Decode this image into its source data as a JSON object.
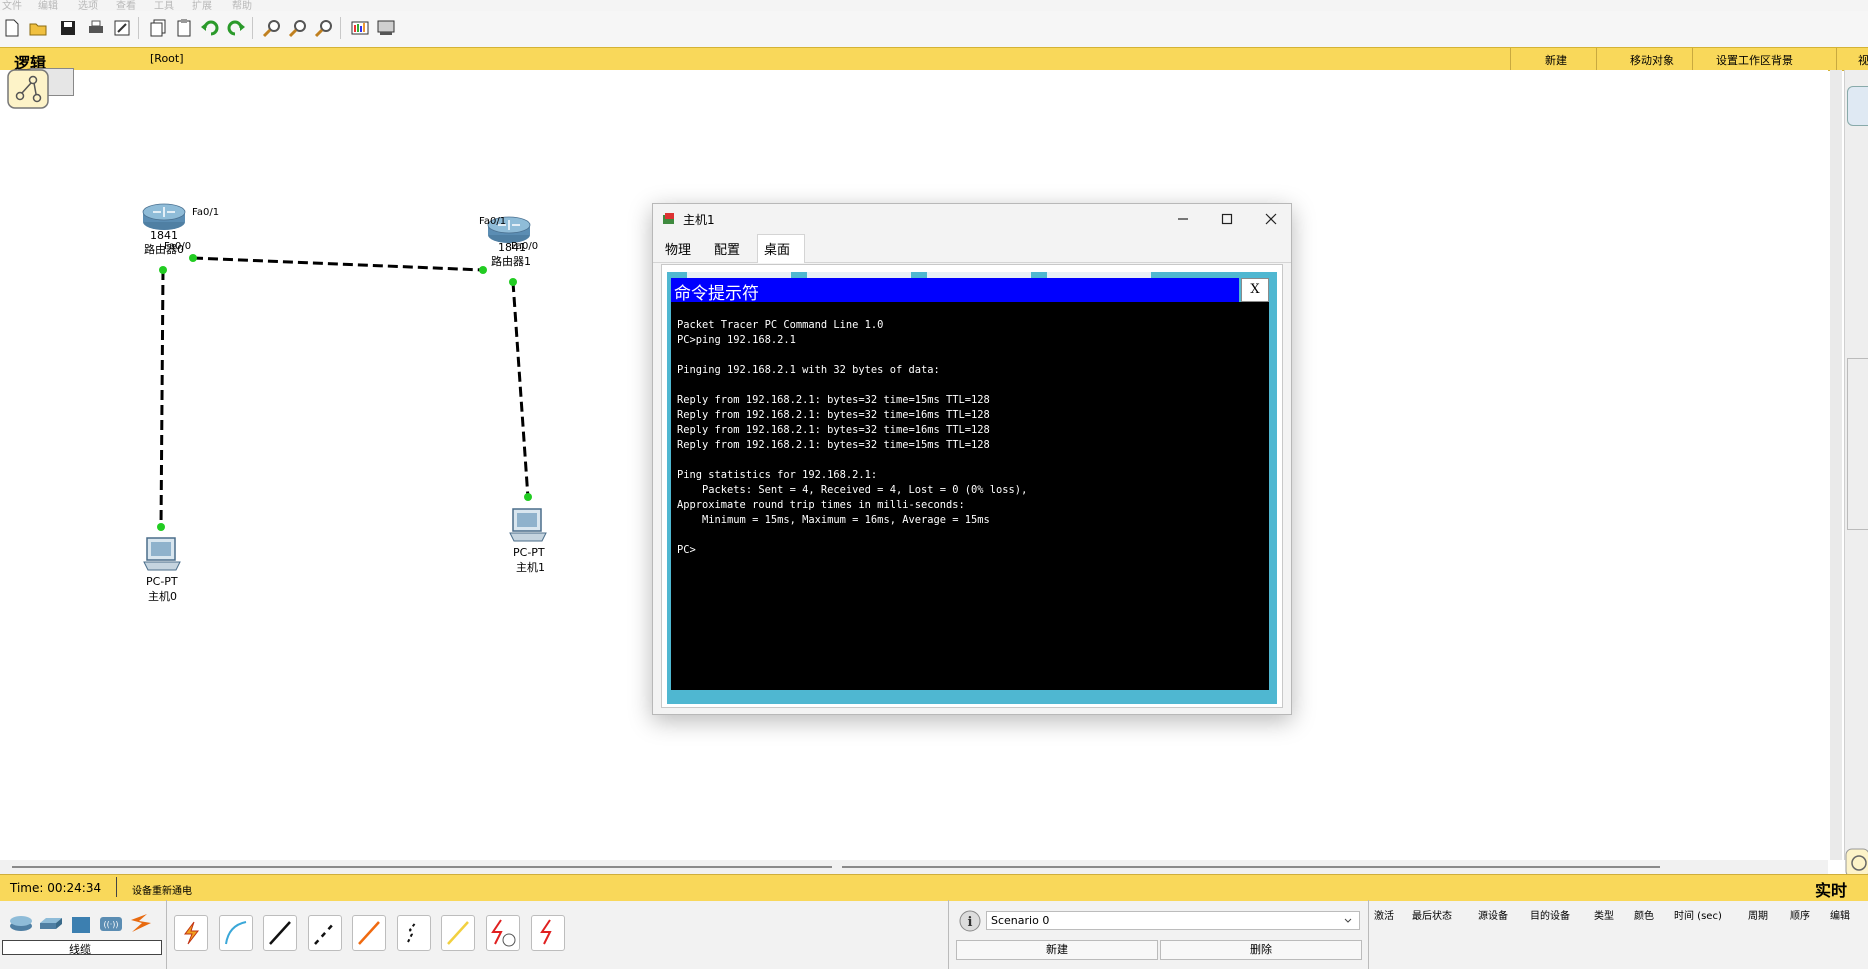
{
  "menu": [
    "文件",
    "编辑",
    "选项",
    "查看",
    "工具",
    "扩展",
    "帮助"
  ],
  "workspace": {
    "tab_label": "逻辑",
    "root_label": "[Root]",
    "actions": [
      "新建",
      "移动对象",
      "设置工作区背景"
    ],
    "right_edge_label": "视"
  },
  "devices": {
    "router0": {
      "model": "1841",
      "name": "路由器0",
      "port_a": "Fa0/1",
      "port_b": "Fa0/0"
    },
    "router1": {
      "model": "1841",
      "name": "路由器1",
      "port_a": "Fa0/1",
      "port_b": "Fa0/0"
    },
    "pc0": {
      "type": "PC-PT",
      "name": "主机0"
    },
    "pc1": {
      "type": "PC-PT",
      "name": "主机1"
    }
  },
  "dialog": {
    "title": "主机1",
    "tabs": [
      "物理",
      "配置",
      "桌面"
    ],
    "active_tab": "桌面",
    "cmd_title": "命令提示符",
    "cmd_close": "X",
    "cmd_lines": [
      "Packet Tracer PC Command Line 1.0",
      "PC>ping 192.168.2.1",
      "",
      "Pinging 192.168.2.1 with 32 bytes of data:",
      "",
      "Reply from 192.168.2.1: bytes=32 time=15ms TTL=128",
      "Reply from 192.168.2.1: bytes=32 time=16ms TTL=128",
      "Reply from 192.168.2.1: bytes=32 time=16ms TTL=128",
      "Reply from 192.168.2.1: bytes=32 time=15ms TTL=128",
      "",
      "Ping statistics for 192.168.2.1:",
      "    Packets: Sent = 4, Received = 4, Lost = 0 (0% loss),",
      "Approximate round trip times in milli-seconds:",
      "    Minimum = 15ms, Maximum = 16ms, Average = 15ms",
      "",
      "PC>"
    ]
  },
  "status": {
    "time": "Time: 00:24:34",
    "message": "设备重新通电",
    "mode": "实时"
  },
  "bottom": {
    "device_category": "线缆",
    "scenario_value": "Scenario 0",
    "new_button": "新建",
    "delete_button": "删除",
    "pdu_headers": [
      "激活",
      "最后状态",
      "源设备",
      "目的设备",
      "类型",
      "颜色",
      "时间 (sec)",
      "周期",
      "顺序",
      "编辑"
    ]
  },
  "colors": {
    "yellow_bar": "#f9d85a",
    "cmd_header": "#0000ff",
    "cmd_frame": "#4fb7d1",
    "link_endpoint": "#22cc22"
  }
}
